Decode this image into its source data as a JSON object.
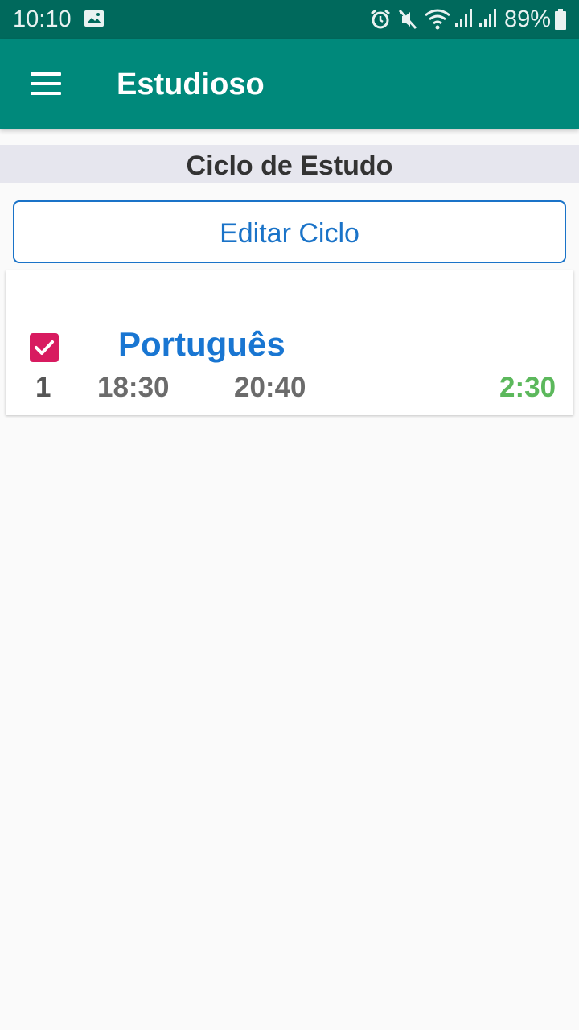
{
  "status_bar": {
    "time": "10:10",
    "battery": "89%",
    "icons": [
      "gallery-icon",
      "alarm-icon",
      "mute-icon",
      "wifi-icon",
      "signal-icon",
      "signal-icon",
      "battery-icon"
    ]
  },
  "app_bar": {
    "title": "Estudioso",
    "menu_icon": "hamburger-menu-icon"
  },
  "section": {
    "title": "Ciclo de Estudo"
  },
  "edit_button": {
    "label": "Editar Ciclo"
  },
  "cycle_items": [
    {
      "subject": "Português",
      "checked": true,
      "index": "1",
      "start": "18:30",
      "end": "20:40",
      "duration": "2:30"
    }
  ],
  "colors": {
    "status_bar": "#00695c",
    "app_bar": "#00897b",
    "checkbox": "#d81b60",
    "subject": "#1976d2",
    "duration": "#5cb85c",
    "button_accent": "#1a73c8"
  }
}
